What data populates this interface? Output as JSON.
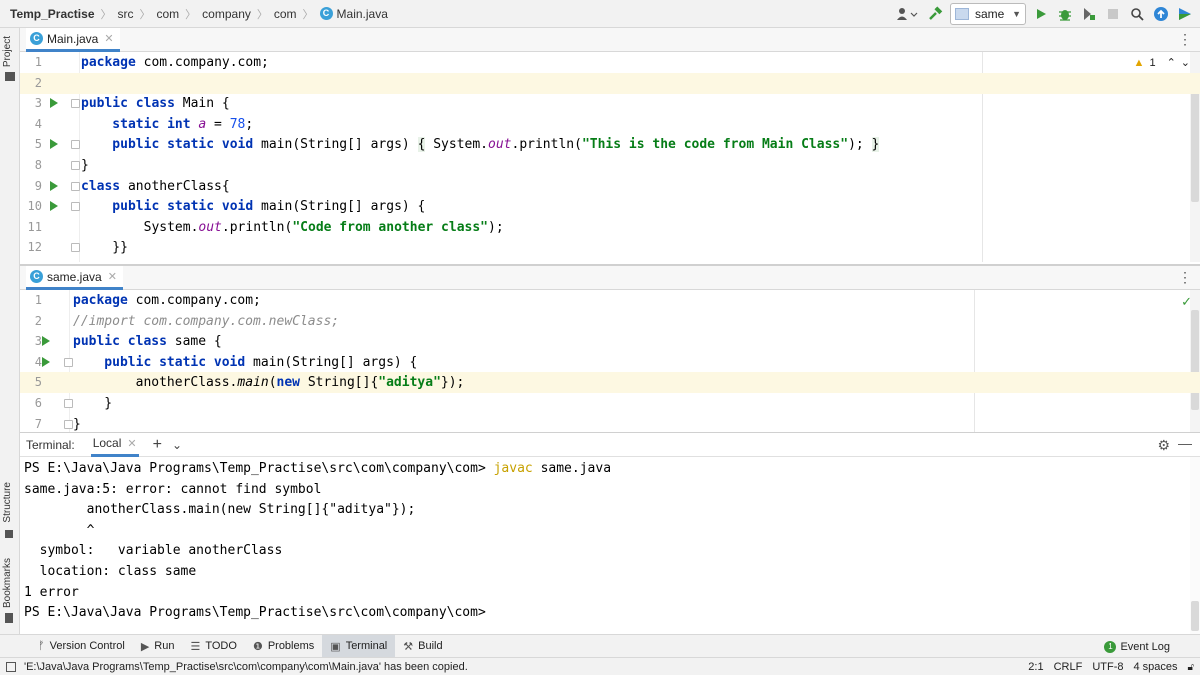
{
  "navbar": {
    "project": "Temp_Practise",
    "crumbs": [
      "src",
      "com",
      "company",
      "com"
    ],
    "file": "Main.java",
    "run_config": "same"
  },
  "side_stripe": {
    "project": "Project",
    "structure": "Structure",
    "bookmarks": "Bookmarks"
  },
  "editor_top": {
    "tab": "Main.java",
    "warning_count": "1",
    "lines": [
      {
        "n": "1",
        "segs": [
          {
            "t": "package ",
            "c": "kw"
          },
          {
            "t": "com.company.com;",
            "c": ""
          }
        ]
      },
      {
        "n": "2",
        "segs": []
      },
      {
        "n": "3",
        "segs": [
          {
            "t": "public class ",
            "c": "kw"
          },
          {
            "t": "Main {",
            "c": ""
          }
        ]
      },
      {
        "n": "4",
        "segs": [
          {
            "t": "    static int ",
            "c": "kw"
          },
          {
            "t": "a",
            "c": "fld"
          },
          {
            "t": " = ",
            "c": ""
          },
          {
            "t": "78",
            "c": "num"
          },
          {
            "t": ";",
            "c": ""
          }
        ]
      },
      {
        "n": "5",
        "segs": [
          {
            "t": "    public static void ",
            "c": "kw"
          },
          {
            "t": "main(String[] args) ",
            "c": ""
          },
          {
            "t": "{",
            "c": "brace-hl"
          },
          {
            "t": " System.",
            "c": ""
          },
          {
            "t": "out",
            "c": "fld"
          },
          {
            "t": ".println(",
            "c": ""
          },
          {
            "t": "\"This is the code from Main Class\"",
            "c": "str"
          },
          {
            "t": "); ",
            "c": ""
          },
          {
            "t": "}",
            "c": "brace-hl"
          }
        ]
      },
      {
        "n": "8",
        "segs": [
          {
            "t": "}",
            "c": ""
          }
        ]
      },
      {
        "n": "9",
        "segs": [
          {
            "t": "class ",
            "c": "kw"
          },
          {
            "t": "anotherClass{",
            "c": ""
          }
        ]
      },
      {
        "n": "10",
        "segs": [
          {
            "t": "    public static void ",
            "c": "kw"
          },
          {
            "t": "main(String[] args) {",
            "c": ""
          }
        ]
      },
      {
        "n": "11",
        "segs": [
          {
            "t": "        System.",
            "c": ""
          },
          {
            "t": "out",
            "c": "fld"
          },
          {
            "t": ".println(",
            "c": ""
          },
          {
            "t": "\"Code from another class\"",
            "c": "str"
          },
          {
            "t": ");",
            "c": ""
          }
        ]
      },
      {
        "n": "12",
        "segs": [
          {
            "t": "    }}",
            "c": ""
          }
        ]
      }
    ]
  },
  "editor_bottom": {
    "tab": "same.java",
    "lines": [
      {
        "n": "1",
        "segs": [
          {
            "t": "package ",
            "c": "kw"
          },
          {
            "t": "com.company.com;",
            "c": ""
          }
        ]
      },
      {
        "n": "2",
        "segs": [
          {
            "t": "//import com.company.com.newClass;",
            "c": "cmt"
          }
        ]
      },
      {
        "n": "3",
        "segs": [
          {
            "t": "public class ",
            "c": "kw"
          },
          {
            "t": "same {",
            "c": ""
          }
        ]
      },
      {
        "n": "4",
        "segs": [
          {
            "t": "    public static void ",
            "c": "kw"
          },
          {
            "t": "main(String[] args) {",
            "c": ""
          }
        ]
      },
      {
        "n": "5",
        "segs": [
          {
            "t": "        anotherClass.",
            "c": ""
          },
          {
            "t": "main",
            "c": "italfn"
          },
          {
            "t": "(",
            "c": ""
          },
          {
            "t": "new ",
            "c": "kw"
          },
          {
            "t": "String[]{",
            "c": ""
          },
          {
            "t": "\"aditya\"",
            "c": "str"
          },
          {
            "t": "});",
            "c": ""
          }
        ]
      },
      {
        "n": "6",
        "segs": [
          {
            "t": "    }",
            "c": ""
          }
        ]
      },
      {
        "n": "7",
        "segs": [
          {
            "t": "}",
            "c": ""
          }
        ]
      }
    ]
  },
  "terminal": {
    "title": "Terminal:",
    "tab": "Local",
    "lines": [
      {
        "segs": [
          {
            "t": "PS E:\\Java\\Java Programs\\Temp_Practise\\src\\com\\company\\com> ",
            "c": ""
          },
          {
            "t": "javac",
            "c": "cmd"
          },
          {
            "t": " same.java",
            "c": ""
          }
        ]
      },
      {
        "segs": [
          {
            "t": "same.java:5: error: cannot find symbol",
            "c": ""
          }
        ]
      },
      {
        "segs": [
          {
            "t": "        anotherClass.main(new String[]{\"aditya\"});",
            "c": ""
          }
        ]
      },
      {
        "segs": [
          {
            "t": "        ^",
            "c": ""
          }
        ]
      },
      {
        "segs": [
          {
            "t": "  symbol:   variable anotherClass",
            "c": ""
          }
        ]
      },
      {
        "segs": [
          {
            "t": "  location: class same",
            "c": ""
          }
        ]
      },
      {
        "segs": [
          {
            "t": "1 error",
            "c": ""
          }
        ]
      },
      {
        "segs": [
          {
            "t": "PS E:\\Java\\Java Programs\\Temp_Practise\\src\\com\\company\\com>",
            "c": ""
          }
        ]
      }
    ]
  },
  "tool_windows": [
    {
      "label": "Version Control",
      "icon": "branch-icon",
      "glyph": "ᚠ"
    },
    {
      "label": "Run",
      "icon": "run-icon",
      "glyph": "▶"
    },
    {
      "label": "TODO",
      "icon": "todo-icon",
      "glyph": "☰"
    },
    {
      "label": "Problems",
      "icon": "problems-icon",
      "glyph": "❶"
    },
    {
      "label": "Terminal",
      "icon": "terminal-icon",
      "glyph": "▣"
    },
    {
      "label": "Build",
      "icon": "hammer-icon",
      "glyph": "⚒"
    }
  ],
  "event_log": {
    "label": "Event Log",
    "count": "1"
  },
  "status": {
    "message": "'E:\\Java\\Java Programs\\Temp_Practise\\src\\com\\company\\com\\Main.java' has been copied.",
    "position": "2:1",
    "line_sep": "CRLF",
    "encoding": "UTF-8",
    "indent": "4 spaces"
  },
  "colors": {
    "keyword": "#0033b3",
    "string": "#067d17",
    "number": "#1750eb",
    "accent": "#4083c9",
    "run_green": "#3a9a3a"
  }
}
